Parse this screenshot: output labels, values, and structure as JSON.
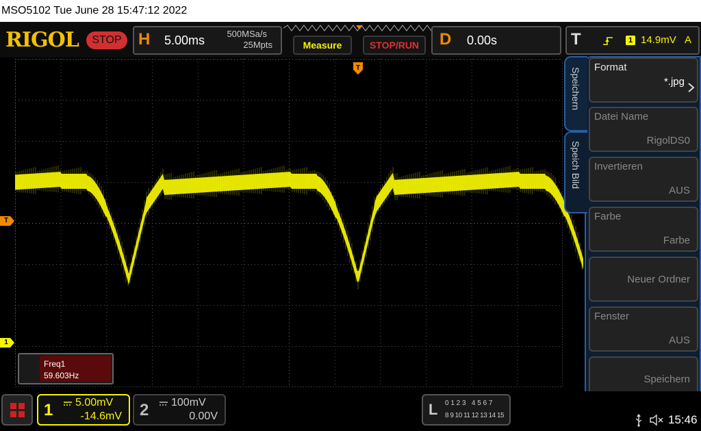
{
  "titlebar": {
    "text": "MSO5102  Tue June 28 15:47:12 2022"
  },
  "header": {
    "logo": "RIGOL",
    "run_state": "STOP",
    "h_letter": "H",
    "timebase": "5.00ms",
    "sample_rate": "500MSa/s",
    "memory_depth": "25Mpts",
    "measure_label": "Measure",
    "stoprun_label": "STOP/RUN",
    "d_letter": "D",
    "delay": "0.00s",
    "t_letter": "T",
    "trigger_channel": "1",
    "trigger_level": "14.9mV",
    "trigger_coupling": "A"
  },
  "markers": {
    "trigger_top": "T",
    "trigger_left": "T",
    "ch1": "1"
  },
  "measurement": {
    "name": "Freq1",
    "value": "59.603Hz"
  },
  "menu": {
    "tabs": [
      "Speichern",
      "Speich Bild"
    ],
    "items": [
      {
        "label": "Format",
        "value": "*.jpg"
      },
      {
        "label": "Datei Name",
        "value": "RigolDS0"
      },
      {
        "label": "Invertieren",
        "value": "AUS"
      },
      {
        "label": "Farbe",
        "value": "Farbe"
      },
      {
        "label": "",
        "value": "Neuer Ordner"
      },
      {
        "label": "Fenster",
        "value": "AUS"
      },
      {
        "label": "",
        "value": "Speichern"
      }
    ]
  },
  "channels": {
    "ch1": {
      "number": "1",
      "scale": "5.00mV",
      "offset": "-14.6mV",
      "color": "#f5f500"
    },
    "ch2": {
      "number": "2",
      "scale": "100mV",
      "offset": "0.00V"
    }
  },
  "logic": {
    "letter": "L",
    "row1": "0 1 2 3   4 5 6 7",
    "row2": "8 9 10 11 12 13 14 15"
  },
  "status": {
    "time": "15:46"
  },
  "colors": {
    "trace": "#f5f500",
    "accent_orange": "#f08a00",
    "menu_blue": "#2a5ea0"
  }
}
